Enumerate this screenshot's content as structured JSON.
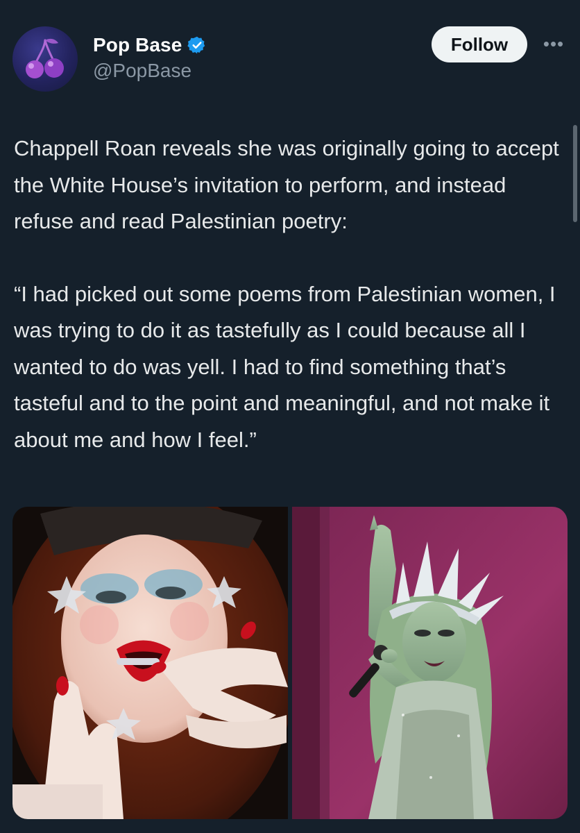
{
  "author": {
    "display_name": "Pop Base",
    "handle": "@PopBase",
    "verified": true,
    "avatar_icon": "cherry-icon"
  },
  "actions": {
    "follow_label": "Follow",
    "more_label": "•••"
  },
  "tweet": {
    "paragraphs": [
      "Chappell Roan reveals she was originally going to accept the White House’s invitation to perform, and instead refuse and read Palestinian poetry:",
      "“I had picked out some poems from Palestinian women, I was trying to do it as tastefully as I could because all I wanted to do was yell. I had to find something that’s tasteful and to the point and meaningful, and not make it about me and how I feel.”"
    ]
  },
  "media": {
    "photos": [
      {
        "icon": "portrait-photo"
      },
      {
        "icon": "performance-photo"
      }
    ]
  },
  "colors": {
    "background": "#15202b",
    "text": "#e7e9ea",
    "secondary_text": "#8b98a5",
    "verified": "#1d9bf0",
    "follow_button_bg": "#eff3f4"
  }
}
